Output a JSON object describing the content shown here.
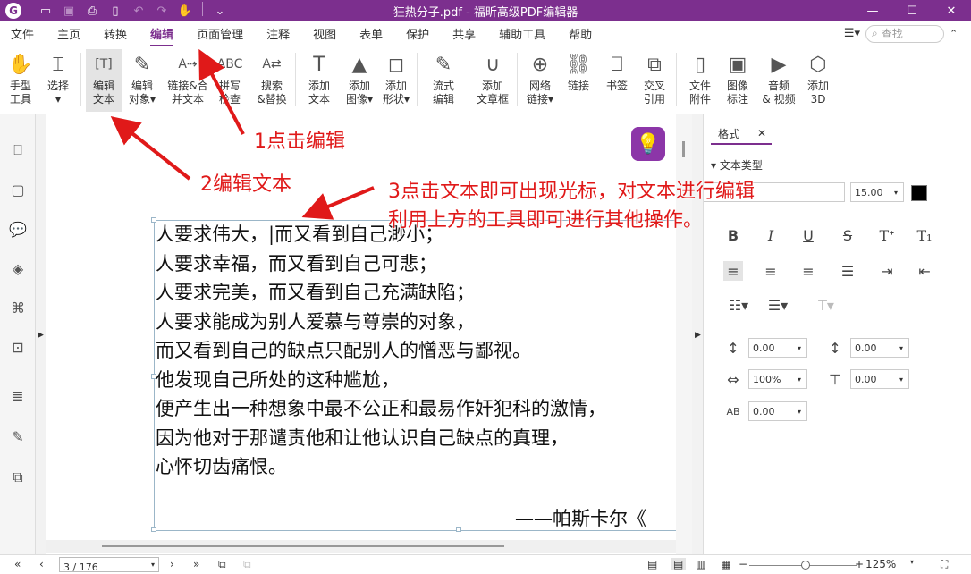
{
  "window": {
    "title": "狂热分子.pdf - 福昕高级PDF编辑器"
  },
  "menu": {
    "items": [
      "文件",
      "主页",
      "转换",
      "编辑",
      "页面管理",
      "注释",
      "视图",
      "表单",
      "保护",
      "共享",
      "辅助工具",
      "帮助"
    ],
    "active": "编辑",
    "search_placeholder": "查找"
  },
  "toolbar": [
    {
      "l1": "手型",
      "l2": "工具",
      "icon": "hand-icon"
    },
    {
      "l1": "选择",
      "l2": "▾",
      "icon": "select-cursor-icon"
    },
    {
      "l1": "编辑",
      "l2": "文本",
      "icon": "edit-text-icon",
      "selected": true
    },
    {
      "l1": "编辑",
      "l2": "对象▾",
      "icon": "edit-object-icon"
    },
    {
      "l1": "链接&合",
      "l2": "并文本",
      "icon": "link-merge-text-icon"
    },
    {
      "l1": "拼写",
      "l2": "检查",
      "icon": "spell-check-icon"
    },
    {
      "l1": "搜索",
      "l2": "&替换",
      "icon": "search-replace-icon"
    },
    {
      "l1": "添加",
      "l2": "文本",
      "icon": "add-text-icon"
    },
    {
      "l1": "添加",
      "l2": "图像▾",
      "icon": "add-image-icon"
    },
    {
      "l1": "添加",
      "l2": "形状▾",
      "icon": "add-shape-icon"
    },
    {
      "l1": "流式",
      "l2": "编辑",
      "icon": "flow-edit-icon"
    },
    {
      "l1": "添加",
      "l2": "文章框",
      "icon": "add-article-box-icon"
    },
    {
      "l1": "网络",
      "l2": "链接▾",
      "icon": "web-link-icon"
    },
    {
      "l1": "链接",
      "l2": "",
      "icon": "link-icon"
    },
    {
      "l1": "书签",
      "l2": "",
      "icon": "bookmark-icon"
    },
    {
      "l1": "交叉",
      "l2": "引用",
      "icon": "cross-reference-icon"
    },
    {
      "l1": "文件",
      "l2": "附件",
      "icon": "file-attachment-icon"
    },
    {
      "l1": "图像",
      "l2": "标注",
      "icon": "image-annotation-icon"
    },
    {
      "l1": "音频",
      "l2": "& 视频",
      "icon": "audio-video-icon"
    },
    {
      "l1": "添加",
      "l2": "3D",
      "icon": "add-3d-icon"
    }
  ],
  "document": {
    "lines": [
      "人要求伟大，|而又看到自己渺小；",
      "人要求幸福，而又看到自己可悲；",
      "人要求完美，而又看到自己充满缺陷；",
      "人要求能成为别人爱慕与尊崇的对象，",
      "而又看到自己的缺点只配别人的憎恶与鄙视。",
      "他发现自己所处的这种尴尬，",
      "便产生出一种想象中最不公正和最易作奸犯科的激情，",
      "因为他对于那谴责他和让他认识自己缺点的真理，",
      "心怀切齿痛恨。"
    ],
    "signature": "——帕斯卡尔《"
  },
  "annotations": {
    "a1": "1点击编辑",
    "a2": "2编辑文本",
    "a3_line1": "3点击文本即可出现光标，对文本进行编辑",
    "a3_line2": "利用上方的工具即可进行其他操作。"
  },
  "format_panel": {
    "tab": "格式",
    "section": "文本类型",
    "font_size": "15.00",
    "color": "#000000",
    "line_spacing": "0.00",
    "para_spacing": "0.00",
    "char_scale": "100%",
    "baseline": "0.00",
    "char_spacing": "0.00"
  },
  "status": {
    "page": "3 / 176",
    "zoom": "125%"
  },
  "colors": {
    "brand": "#7c2f8e",
    "annotation": "#e01919"
  }
}
